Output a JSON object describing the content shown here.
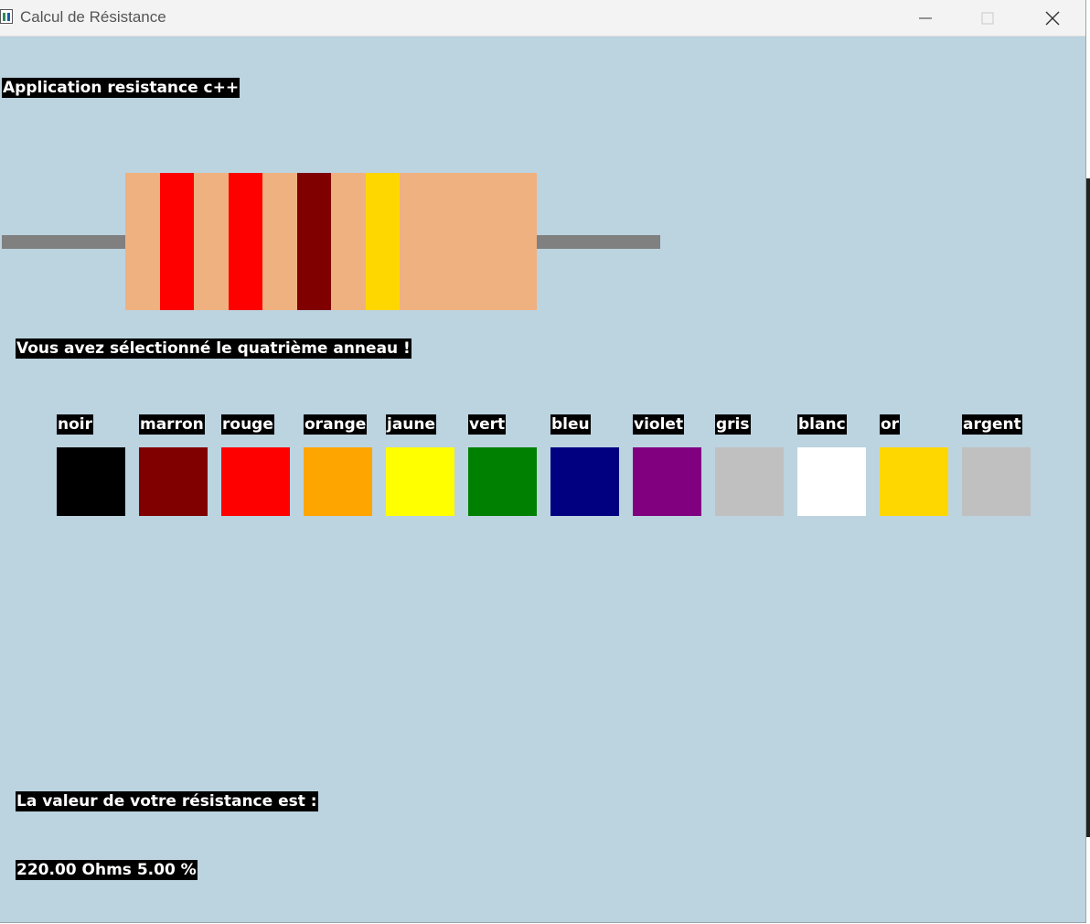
{
  "window": {
    "title": "Calcul de Résistance",
    "background": "#bcd3e0"
  },
  "header": {
    "app_label": "Application resistance c++"
  },
  "resistor": {
    "body_color": "#efb17f",
    "lead_color": "#808080",
    "bands": [
      {
        "name": "rouge",
        "color": "#ff0000"
      },
      {
        "name": "rouge",
        "color": "#ff0000"
      },
      {
        "name": "marron",
        "color": "#800000"
      },
      {
        "name": "or",
        "color": "#ffd700"
      }
    ]
  },
  "status": {
    "selection_message": "Vous avez sélectionné le quatrième anneau !"
  },
  "palette": [
    {
      "label": "noir",
      "color": "#000000"
    },
    {
      "label": "marron",
      "color": "#800000"
    },
    {
      "label": "rouge",
      "color": "#ff0000"
    },
    {
      "label": "orange",
      "color": "#ffa500"
    },
    {
      "label": "jaune",
      "color": "#ffff00"
    },
    {
      "label": "vert",
      "color": "#008000"
    },
    {
      "label": "bleu",
      "color": "#000080"
    },
    {
      "label": "violet",
      "color": "#800080"
    },
    {
      "label": "gris",
      "color": "#c0c0c0"
    },
    {
      "label": "blanc",
      "color": "#ffffff"
    },
    {
      "label": "or",
      "color": "#ffd700"
    },
    {
      "label": "argent",
      "color": "#c0c0c0"
    }
  ],
  "result": {
    "label": "La valeur de votre résistance est :",
    "value": "220.00 Ohms 5.00 %"
  }
}
